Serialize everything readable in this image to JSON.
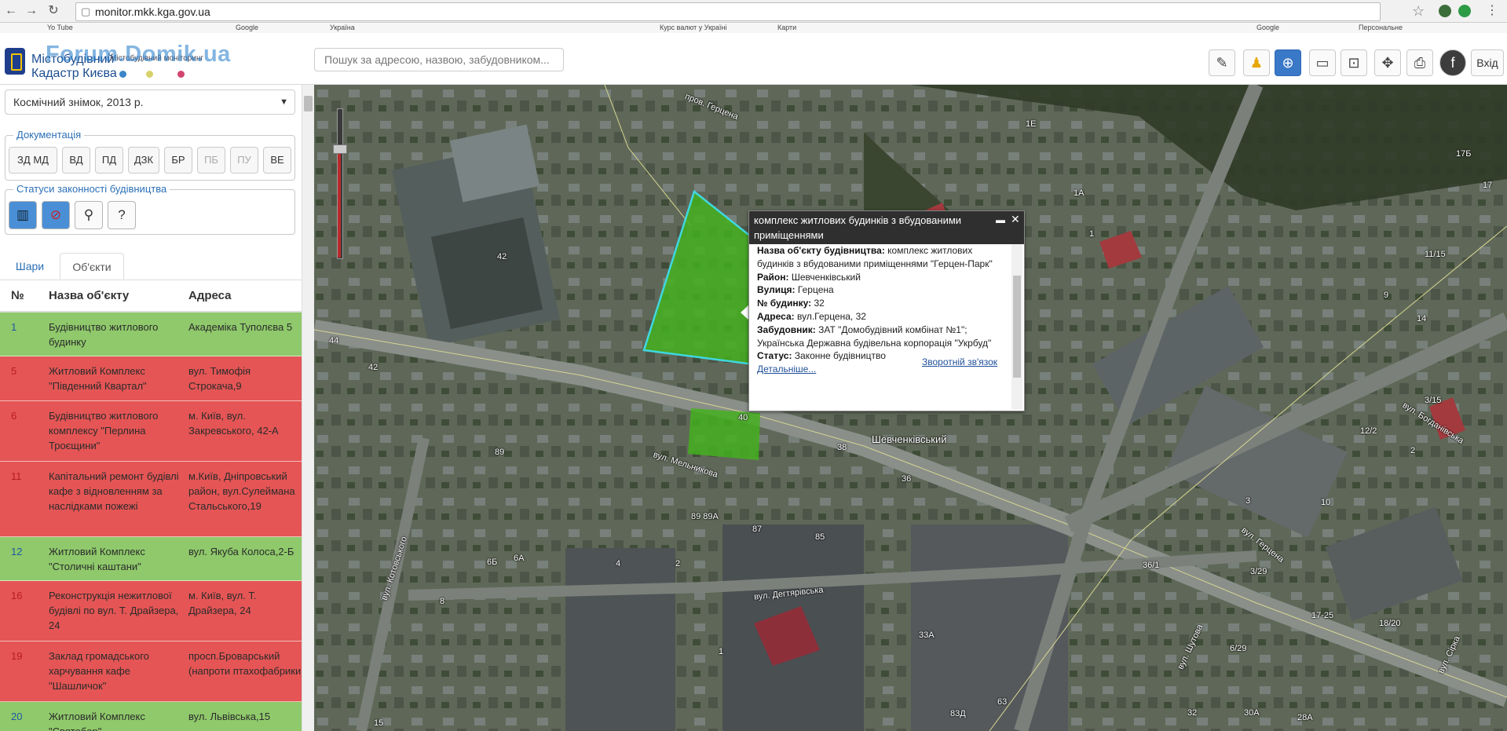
{
  "browser": {
    "url": "monitor.mkk.kga.gov.ua",
    "bookmarks": [
      "Yo Tube",
      "Google",
      "Україна",
      "Курс валют у Україні",
      "Карти",
      "Google",
      "Персональне"
    ]
  },
  "header": {
    "logo_line1": "Містобудівний",
    "logo_line2": "Кадастр Києва",
    "logo_sub": "Містобудівний моніторинг",
    "watermark": "Forum.Domik.ua",
    "search_placeholder": "Пошук за адресою, назвою, забудовником...",
    "login_label": "Вхід"
  },
  "sidebar": {
    "layer_select_value": "Космічний знімок, 2013 р.",
    "documentation_legend": "Документація",
    "doc_buttons": [
      "ЗД МД",
      "ВД",
      "ПД",
      "ДЗК",
      "БР",
      "ПБ",
      "ПУ",
      "ВЕ"
    ],
    "status_legend": "Статуси законності будівництва",
    "tabs": [
      "Шари",
      "Об'єкти"
    ],
    "table_headers": [
      "№",
      "Назва об'єкту",
      "Адреса"
    ],
    "rows": [
      {
        "num": "1",
        "name": "Будівництво житлового будинку",
        "address": "Академіка Туполєва 5",
        "status": "green"
      },
      {
        "num": "5",
        "name": "Житловий Комплекс \"Південний Квартал\"",
        "address": "вул. Тимофія Строкача,9",
        "status": "red"
      },
      {
        "num": "6",
        "name": "Будівництво житлового комплексу \"Перлина Троєщини\"",
        "address": "м. Київ, вул. Закревського, 42-А",
        "status": "red"
      },
      {
        "num": "11",
        "name": "Капітальний ремонт будівлі кафе з відновленням за наслідками пожежі",
        "address": "м.Київ, Дніпровський район, вул.Сулеймана Стальського,19",
        "status": "red"
      },
      {
        "num": "12",
        "name": "Житловий Комплекс \"Столичні каштани\"",
        "address": "вул. Якуба Колоса,2-Б",
        "status": "green"
      },
      {
        "num": "16",
        "name": "Реконструкція нежитлової будівлі по вул. Т. Драйзера, 24",
        "address": "м. Київ, вул. Т. Драйзера, 24",
        "status": "red"
      },
      {
        "num": "19",
        "name": "Заклад громадського харчування кафе \"Шашличок\"",
        "address": "просп.Броварський (напроти птахофабрики)",
        "status": "red"
      },
      {
        "num": "20",
        "name": "Житловий Комплекс \"Святобор\"",
        "address": "вул. Львівська,15",
        "status": "green"
      }
    ]
  },
  "popup": {
    "title": "комплекс житлових будинків з вбудованими приміщеннями",
    "fields": {
      "name_label": "Назва об'єкту будівництва:",
      "name_value": "комплекс житлових будинків з вбудованими приміщеннями \"Герцен-Парк\"",
      "district_label": "Район:",
      "district_value": "Шевченківський",
      "street_label": "Вулиця:",
      "street_value": "Герцена",
      "house_label": "№ будинку:",
      "house_value": "32",
      "address_label": "Адреса:",
      "address_value": "вул.Герцена, 32",
      "developer_label": "Забудовник:",
      "developer_value": "ЗАТ \"Домобудівний комбінат №1\"; Українська Державна будівельна корпорація \"Укрбуд\"",
      "feedback_link": "Зворотній зв'язок",
      "status_label": "Статус:",
      "status_value": "Законне будівництво",
      "details_link": "Детальніше..."
    }
  },
  "map": {
    "labels": {
      "street_gertsena_top": "пров. Герцена",
      "street_melnykova": "вул. Мельникова",
      "street_dehtyarivska": "вул. Дегтярівська",
      "street_gertsena": "вул. Герцена",
      "street_bohdanivska": "вул. Богданівська",
      "street_kotovskoho": "вул. Котовського",
      "street_shutova": "вул. Шутова",
      "street_sirko": "вул. Сірка",
      "district": "Шевченківський",
      "n42a": "42",
      "n42b": "42",
      "n44": "44",
      "n89": "89",
      "n38": "38",
      "n36": "36",
      "n6a": "6А",
      "n6b": "6Б",
      "n4": "4",
      "n2": "2",
      "n8": "8",
      "n85": "85",
      "n87": "87",
      "n89a": "89 89А",
      "n33a": "33А",
      "n1": "1",
      "n36_1": "36/1",
      "n1a": "1А",
      "n1_2": "1",
      "n11_15": "11/15",
      "n17b": "17Б",
      "n17": "17",
      "n12_2": "12/2",
      "n2b": "2",
      "n3_15": "3/15",
      "n10": "10",
      "n3_29": "3/29",
      "n17_25": "17-25",
      "n18_20": "18/20",
      "n6_29": "6/29",
      "n30a": "30А",
      "n28a": "28А",
      "n32": "32",
      "n63": "63",
      "n83d": "83Д",
      "n15": "15",
      "n40": "40",
      "n14": "14",
      "n9": "9",
      "n3": "3",
      "n1e": "1Е"
    }
  },
  "colors": {
    "green_row": "#8fc96b",
    "red_row": "#e55555",
    "accent": "#2c6fb6",
    "polygon": "#44b01e"
  }
}
